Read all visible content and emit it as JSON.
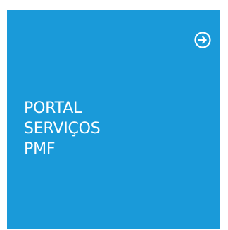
{
  "tile": {
    "title_lines": [
      "PORTAL",
      "SERVIÇOS",
      "PMF"
    ],
    "icon": "arrow-right-circle-icon",
    "background_color": "#1a9ad9",
    "text_color": "#ffffff"
  }
}
